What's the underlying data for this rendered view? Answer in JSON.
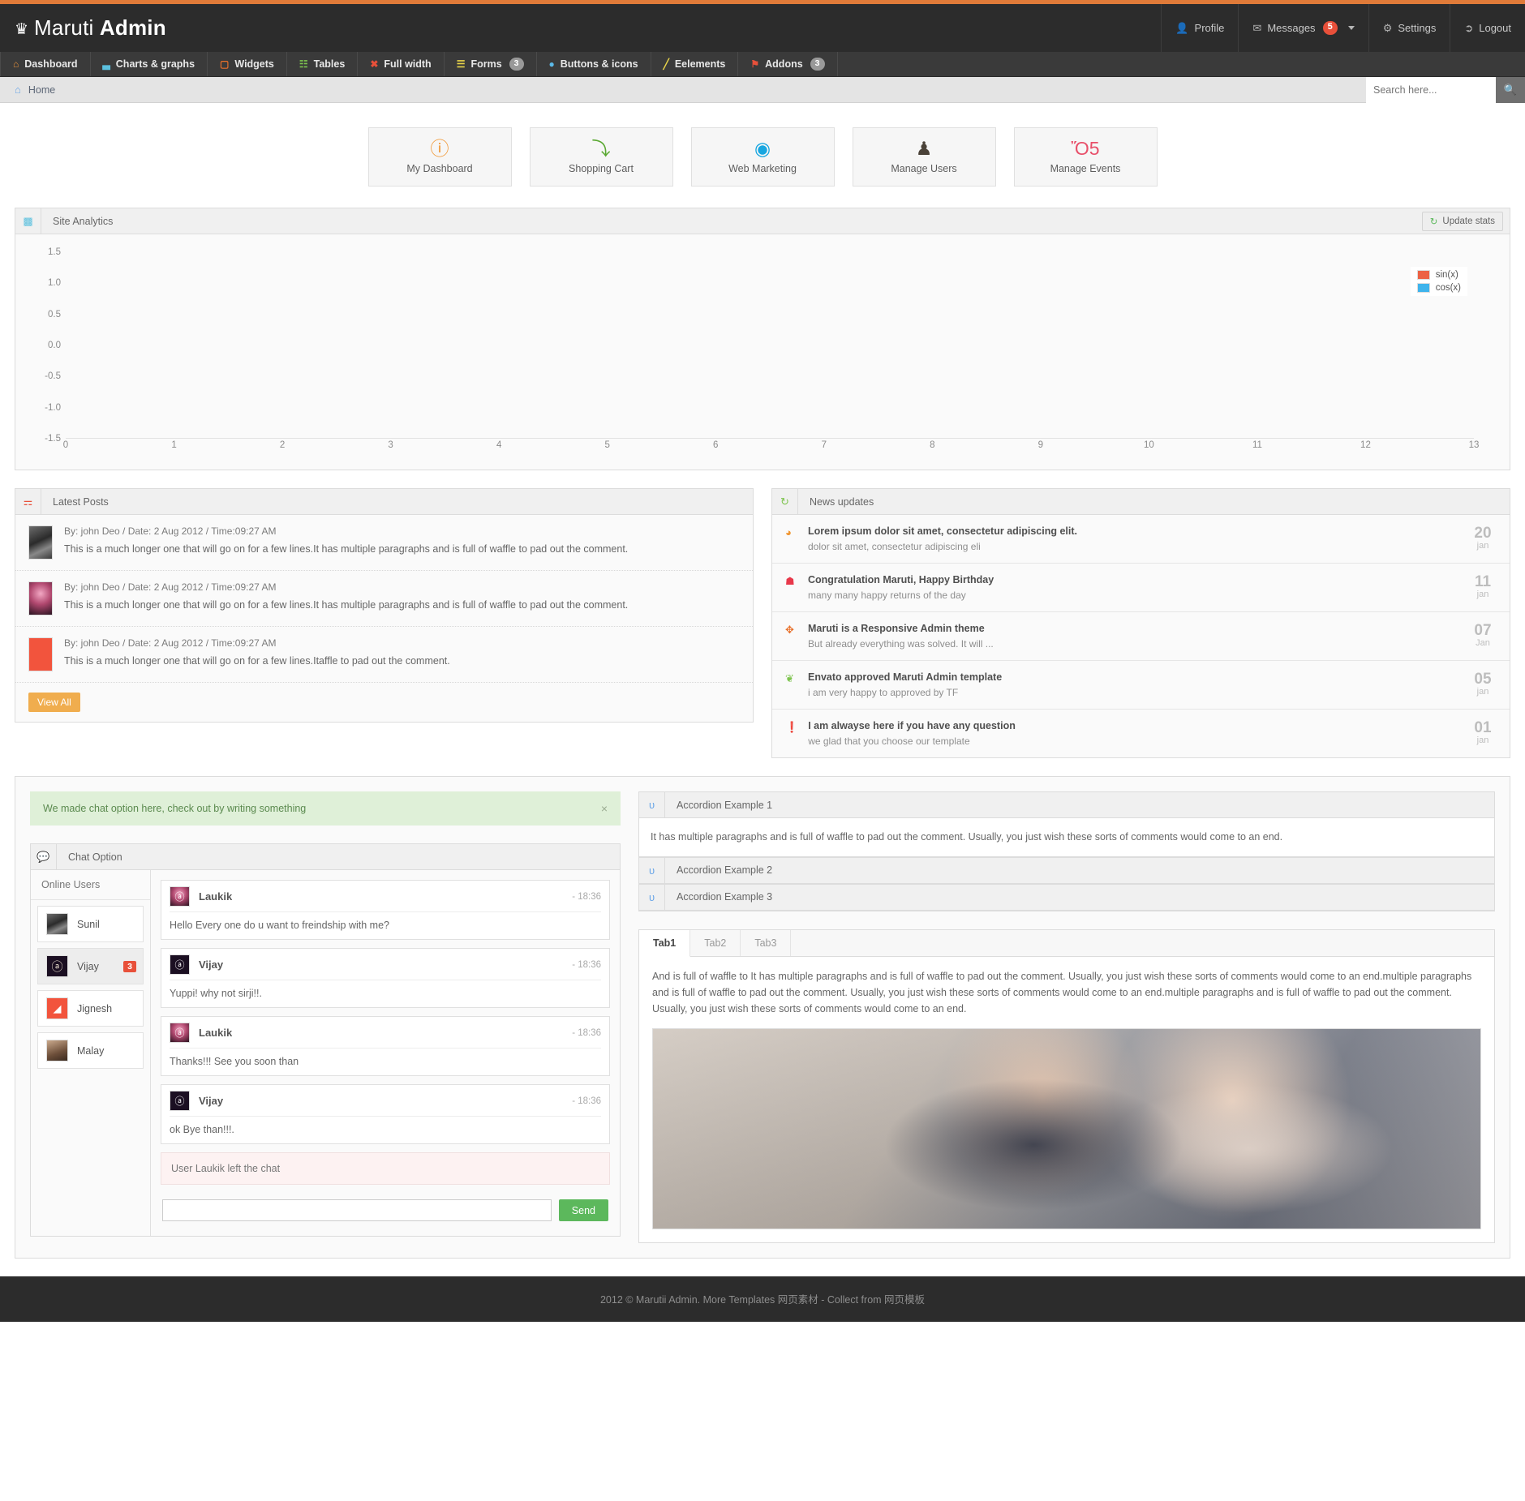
{
  "brand": {
    "crown_icon": "crown-icon",
    "name_light": "Maruti",
    "name_bold": "Admin"
  },
  "header_right": {
    "profile": {
      "label": "Profile",
      "icon": "user-icon"
    },
    "messages": {
      "label": "Messages",
      "icon": "envelope-icon",
      "badge": "5"
    },
    "settings": {
      "label": "Settings",
      "icon": "gear-icon"
    },
    "logout": {
      "label": "Logout",
      "icon": "logout-arrow-icon"
    }
  },
  "nav": [
    {
      "label": "Dashboard",
      "icon": "home-icon",
      "color": "#e8903a",
      "glyph": "⌂",
      "badge": null
    },
    {
      "label": "Charts & graphs",
      "icon": "bar-chart-icon",
      "color": "#5bc0de",
      "glyph": "▃",
      "badge": null
    },
    {
      "label": "Widgets",
      "icon": "widget-box-icon",
      "color": "#e8702a",
      "glyph": "▢",
      "badge": null
    },
    {
      "label": "Tables",
      "icon": "table-grid-icon",
      "color": "#7ec44f",
      "glyph": "☷",
      "badge": null
    },
    {
      "label": "Full width",
      "icon": "expand-icon",
      "color": "#e8503a",
      "glyph": "✖",
      "badge": null
    },
    {
      "label": "Forms",
      "icon": "form-list-icon",
      "color": "#e8d44a",
      "glyph": "☰",
      "badge": "3"
    },
    {
      "label": "Buttons & icons",
      "icon": "droplet-icon",
      "color": "#5bb9e8",
      "glyph": "●",
      "badge": null
    },
    {
      "label": "Eelements",
      "icon": "pencil-icon",
      "color": "#e8d44a",
      "glyph": "╱",
      "badge": null
    },
    {
      "label": "Addons",
      "icon": "page-icon",
      "color": "#e8503a",
      "glyph": "⚑",
      "badge": "3"
    }
  ],
  "breadcrumb": {
    "home_icon": "home-icon",
    "label": "Home"
  },
  "search": {
    "placeholder": "Search here...",
    "value": "",
    "button_icon": "search-icon"
  },
  "tiles": [
    {
      "label": "My Dashboard",
      "icon": "dashboard-gauge-icon",
      "glyph": "ⓘ",
      "color": "#f0942e"
    },
    {
      "label": "Shopping Cart",
      "icon": "shopping-cart-icon",
      "glyph": "⤵",
      "color": "#5aa832"
    },
    {
      "label": "Web Marketing",
      "icon": "globe-icon",
      "glyph": "◉",
      "color": "#17a6e0"
    },
    {
      "label": "Manage Users",
      "icon": "user-silhouette-icon",
      "glyph": "♟",
      "color": "#4a4238"
    },
    {
      "label": "Manage Events",
      "icon": "calendar-icon",
      "glyph": "Ὄ5",
      "color": "#e8506a"
    }
  ],
  "analytics": {
    "icon": "bar-chart-icon",
    "title": "Site Analytics",
    "update_button": {
      "label": "Update stats",
      "icon": "refresh-icon"
    }
  },
  "chart_data": {
    "type": "line",
    "title": "Site Analytics",
    "xlabel": "",
    "ylabel": "",
    "grid": false,
    "legend_position": "top-right",
    "xlim": [
      0,
      13
    ],
    "ylim": [
      -1.5,
      1.5
    ],
    "x_ticks": [
      "0",
      "1",
      "2",
      "3",
      "4",
      "5",
      "6",
      "7",
      "8",
      "9",
      "10",
      "11",
      "12",
      "13"
    ],
    "y_ticks": [
      "1.5",
      "1.0",
      "0.5",
      "0.0",
      "-0.5",
      "-1.0",
      "-1.5"
    ],
    "series": [
      {
        "name": "sin(x)",
        "color": "#ec6244",
        "values": []
      },
      {
        "name": "cos(x)",
        "color": "#3fb4ec",
        "values": []
      }
    ],
    "note": "Plot lines not rendered in screenshot; axes and legend only."
  },
  "latest_posts": {
    "icon": "document-icon",
    "title": "Latest Posts",
    "view_all_label": "View All",
    "items": [
      {
        "avatar": "av-sunil",
        "meta": "By: john Deo / Date: 2 Aug 2012 / Time:09:27 AM",
        "text": "This is a much longer one that will go on for a few lines.It has multiple paragraphs and is full of waffle to pad out the comment."
      },
      {
        "avatar": "av-laukik",
        "meta": "By: john Deo / Date: 2 Aug 2012 / Time:09:27 AM",
        "text": "This is a much longer one that will go on for a few lines.It has multiple paragraphs and is full of waffle to pad out the comment."
      },
      {
        "avatar": "av-jignesh",
        "meta": "By: john Deo / Date: 2 Aug 2012 / Time:09:27 AM",
        "text": "This is a much longer one that will go on for a few lines.Itaffle to pad out the comment."
      }
    ]
  },
  "news_updates": {
    "icon": "refresh-icon",
    "title": "News updates",
    "items": [
      {
        "icon": "clock-orange-icon",
        "glyph": "◕",
        "color": "#f0942e",
        "title": "Lorem ipsum dolor sit amet, consectetur adipiscing elit.",
        "sub": "dolor sit amet, consectetur adipiscing eli",
        "day": "20",
        "month": "jan"
      },
      {
        "icon": "gift-icon",
        "glyph": "☗",
        "color": "#e8384a",
        "title": "Congratulation Maruti, Happy Birthday",
        "sub": "many many happy returns of the day",
        "day": "11",
        "month": "jan"
      },
      {
        "icon": "move-cross-icon",
        "glyph": "✥",
        "color": "#e8702a",
        "title": "Maruti is a Responsive Admin theme",
        "sub": "But already everything was solved. It will ...",
        "day": "07",
        "month": "Jan"
      },
      {
        "icon": "leaf-icon",
        "glyph": "❦",
        "color": "#7ec44f",
        "title": "Envato approved Maruti Admin template",
        "sub": "i am very happy to approved by TF",
        "day": "05",
        "month": "jan"
      },
      {
        "icon": "info-green-icon",
        "glyph": "❗",
        "color": "#7ec44f",
        "title": "I am alwayse here if you have any question",
        "sub": "we glad that you choose our template",
        "day": "01",
        "month": "jan"
      }
    ]
  },
  "chat_alert": {
    "text": "We made chat option here, check out by writing something",
    "close_icon": "close-icon",
    "close_glyph": "×"
  },
  "chat": {
    "icon": "speech-bubble-icon",
    "title": "Chat Option",
    "online_users_label": "Online Users",
    "users": [
      {
        "name": "Sunil",
        "avatar": "av-sunil",
        "glyph": "",
        "badge": null,
        "active": false
      },
      {
        "name": "Vijay",
        "avatar": "av-vijay",
        "glyph": "ⓐ",
        "badge": "3",
        "active": true
      },
      {
        "name": "Jignesh",
        "avatar": "av-jignesh",
        "glyph": "◢",
        "badge": null,
        "active": false
      },
      {
        "name": "Malay",
        "avatar": "av-malay",
        "glyph": "",
        "badge": null,
        "active": false
      }
    ],
    "messages": [
      {
        "name": "Laukik",
        "avatar": "av-laukik",
        "glyph": "ⓐ",
        "time": "- 18:36",
        "text": "Hello Every one do u want to freindship with me?"
      },
      {
        "name": "Vijay",
        "avatar": "av-vijay",
        "glyph": "ⓐ",
        "time": "- 18:36",
        "text": "Yuppi! why not sirji!!."
      },
      {
        "name": "Laukik",
        "avatar": "av-laukik",
        "glyph": "ⓐ",
        "time": "- 18:36",
        "text": "Thanks!!! See you soon than"
      },
      {
        "name": "Vijay",
        "avatar": "av-vijay",
        "glyph": "ⓐ",
        "time": "- 18:36",
        "text": "ok Bye than!!!."
      }
    ],
    "system_message": "User Laukik left the chat",
    "input": {
      "value": "",
      "placeholder": ""
    },
    "send_label": "Send"
  },
  "accordion": {
    "items": [
      {
        "label": "Accordion Example 1",
        "icon": "magnet-icon",
        "glyph": "ᴜ",
        "open": true,
        "body": "It has multiple paragraphs and is full of waffle to pad out the comment. Usually, you just wish these sorts of comments would come to an end."
      },
      {
        "label": "Accordion Example 2",
        "icon": "magnet-icon",
        "glyph": "ᴜ",
        "open": false,
        "body": ""
      },
      {
        "label": "Accordion Example 3",
        "icon": "magnet-icon",
        "glyph": "ᴜ",
        "open": false,
        "body": ""
      }
    ]
  },
  "tabs": {
    "items": [
      {
        "label": "Tab1",
        "active": true
      },
      {
        "label": "Tab2",
        "active": false
      },
      {
        "label": "Tab3",
        "active": false
      }
    ],
    "content_text": "And is full of waffle to It has multiple paragraphs and is full of waffle to pad out the comment. Usually, you just wish these sorts of comments would come to an end.multiple paragraphs and is full of waffle to pad out the comment. Usually, you just wish these sorts of comments would come to an end.multiple paragraphs and is full of waffle to pad out the comment. Usually, you just wish these sorts of comments would come to an end.",
    "image_name": "couple-portrait-photo"
  },
  "footer": {
    "text": "2012 © Marutii Admin. More Templates 网页素材 - Collect from 网页模板"
  }
}
